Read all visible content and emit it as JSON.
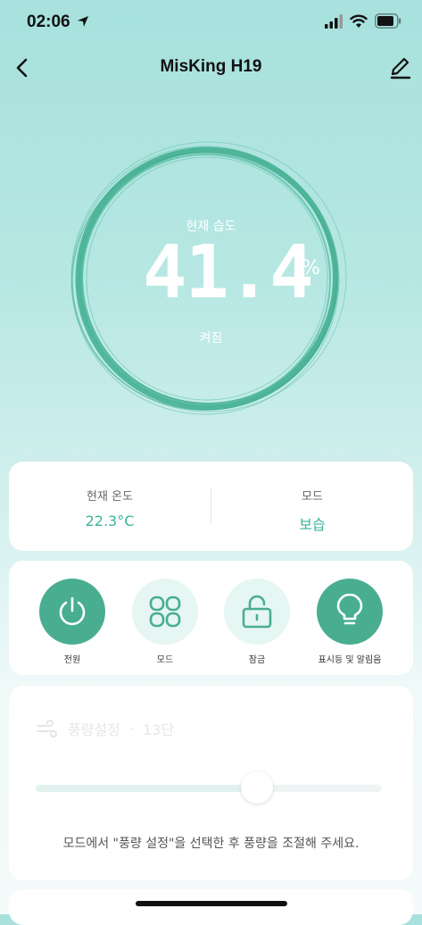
{
  "status_bar": {
    "time": "02:06"
  },
  "header": {
    "title": "MisKing H19"
  },
  "humidity": {
    "label": "현재 습도",
    "value": "41.4",
    "unit": "%",
    "state": "켜짐"
  },
  "info": {
    "temperature": {
      "label": "현재 온도",
      "value": "22.3°C"
    },
    "mode": {
      "label": "모드",
      "value": "보습"
    }
  },
  "controls": [
    {
      "label": "전원",
      "icon": "power-icon",
      "active": true
    },
    {
      "label": "모드",
      "icon": "mode-grid-icon",
      "active": false
    },
    {
      "label": "잠금",
      "icon": "unlock-icon",
      "active": false
    },
    {
      "label": "표시등 및 알림음",
      "icon": "lightbulb-icon",
      "active": true
    }
  ],
  "fan": {
    "title": "풍량설정",
    "separator": "·",
    "level": "13단",
    "slider_level": 0.64,
    "hint": "모드에서 \"풍량 설정\"을 선택한 후 풍량을 조절해 주세요."
  },
  "colors": {
    "accent": "#49ae90",
    "accent_text": "#3bb49a",
    "ring": "#5fc1a8"
  }
}
